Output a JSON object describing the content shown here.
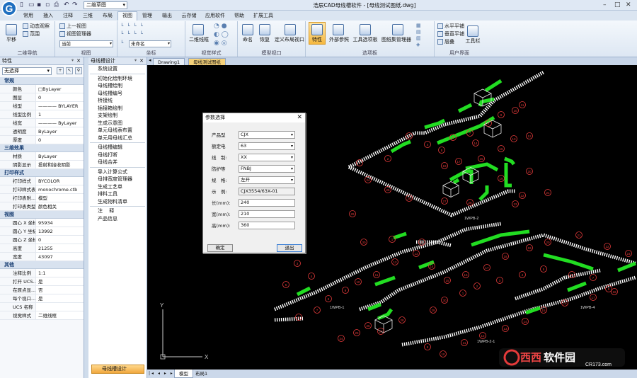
{
  "window": {
    "title": "浩辰CAD母线槽软件 - [母线测试图纸.dwg]",
    "workspace": "二维草图"
  },
  "tabs": [
    "常用",
    "插入",
    "注释",
    "三维",
    "布局",
    "视图",
    "管理",
    "输出",
    "云存储",
    "应用软件",
    "帮助",
    "扩展工具"
  ],
  "active_tab": "视图",
  "ribbon": {
    "nav": {
      "label": "二维导航",
      "pan": "平移",
      "orbit": "动态观察",
      "zoom": "范围"
    },
    "view": {
      "label": "视图",
      "prev": "上一视图",
      "manager": "视图管理器",
      "current": "当前"
    },
    "coords": {
      "label": "坐标",
      "ucs": "未命名"
    },
    "viewstyle": {
      "label": "视觉样式",
      "wire": "二维线框"
    },
    "modelviewport": {
      "label": "模型视口",
      "name": "命名",
      "restore": "恢复",
      "custom": "定义布局视口"
    },
    "palettes": {
      "label": "选项板",
      "props": "特性",
      "xref": "外部参照",
      "tools": "工具选项板",
      "sheet": "图纸集管理器"
    },
    "ui": {
      "label": "用户界面",
      "tile_h": "水平平铺",
      "tile_v": "垂直平铺",
      "cascade": "层叠",
      "toolbar": "工具栏"
    }
  },
  "properties": {
    "title": "特性",
    "selection": "无选择",
    "sections": [
      {
        "name": "常规",
        "rows": [
          [
            "颜色",
            "□ByLayer"
          ],
          [
            "图层",
            "0"
          ],
          [
            "线型",
            "———— BYLAYER"
          ],
          [
            "线型比例",
            "1"
          ],
          [
            "线宽",
            "———— ByLayer"
          ],
          [
            "透明度",
            "ByLayer"
          ],
          [
            "厚度",
            "0"
          ]
        ]
      },
      {
        "name": "三维效果",
        "rows": [
          [
            "材质",
            "ByLayer"
          ],
          [
            "阴影显示",
            "投射和接收阴影"
          ]
        ]
      },
      {
        "name": "打印样式",
        "rows": [
          [
            "打印样式",
            "BYCOLOR"
          ],
          [
            "打印样式表",
            "monochrome.ctb"
          ],
          [
            "打印表附...",
            "模型"
          ],
          [
            "打印表类型",
            "颜色相关"
          ]
        ]
      },
      {
        "name": "视图",
        "rows": [
          [
            "圆心 X 坐标",
            "95934"
          ],
          [
            "圆心 Y 坐标",
            "13992"
          ],
          [
            "圆心 Z 坐标",
            "0"
          ],
          [
            "高度",
            "21255"
          ],
          [
            "宽度",
            "43097"
          ]
        ]
      },
      {
        "name": "其他",
        "rows": [
          [
            "注释比例",
            "1:1"
          ],
          [
            "打开 UCS...",
            "是"
          ],
          [
            "在原点显...",
            "否"
          ],
          [
            "每个视口...",
            "是"
          ],
          [
            "UCS 名称",
            ""
          ],
          [
            "视觉样式",
            "二维线框"
          ]
        ]
      }
    ]
  },
  "busbar": {
    "title": "母线槽设计",
    "items": [
      "系统设置",
      "初始化绘制环境",
      "母线槽绘制",
      "母线槽编号",
      "桥接线",
      "插接箱绘制",
      "支架绘制",
      "生成示意图",
      "单元母线表布置",
      "单元用母线汇总",
      "母线槽编辑",
      "母线打断",
      "母线合并",
      "导入计算公式",
      "母排宽度管理器",
      "生成工艺单",
      "排料工具",
      "生成物料清单",
      "注  　释",
      "产品信息"
    ],
    "footer": "母线槽设计"
  },
  "doc_tabs": [
    "Drawing1",
    "母线测试图纸"
  ],
  "active_doc": "母线测试图纸",
  "layout_tabs": [
    "模型",
    "布局1"
  ],
  "dialog": {
    "title": "参数选择",
    "fields": [
      {
        "label": "产品型",
        "value": "CJX",
        "combo": true
      },
      {
        "label": "额定电",
        "value": "63",
        "combo": true
      },
      {
        "label": "线　制:",
        "value": "XX",
        "combo": true
      },
      {
        "label": "防护等",
        "value": "FNBJ",
        "combo": true
      },
      {
        "label": "规　格:",
        "value": "左开",
        "combo": true
      },
      {
        "label": "示　例:",
        "value": "CJX3554/63X-01",
        "combo": false
      },
      {
        "label": "长(mm):",
        "value": "240",
        "combo": false
      },
      {
        "label": "宽(mm):",
        "value": "210",
        "combo": false
      },
      {
        "label": "高(mm):",
        "value": "360",
        "combo": false
      }
    ],
    "ok": "确定",
    "cancel": "退出"
  },
  "canvas_labels": [
    "1WPB-2",
    "1WPB-1",
    "1WPB-2-1",
    "1WPB-4"
  ],
  "axis": {
    "x": "X",
    "y": "Y"
  },
  "watermark": {
    "brand": "西西软件园",
    "url": "CR173.com"
  },
  "colors": {
    "accent": "#f5b840",
    "busbar": "#22dd22",
    "canvas": "#000000"
  }
}
